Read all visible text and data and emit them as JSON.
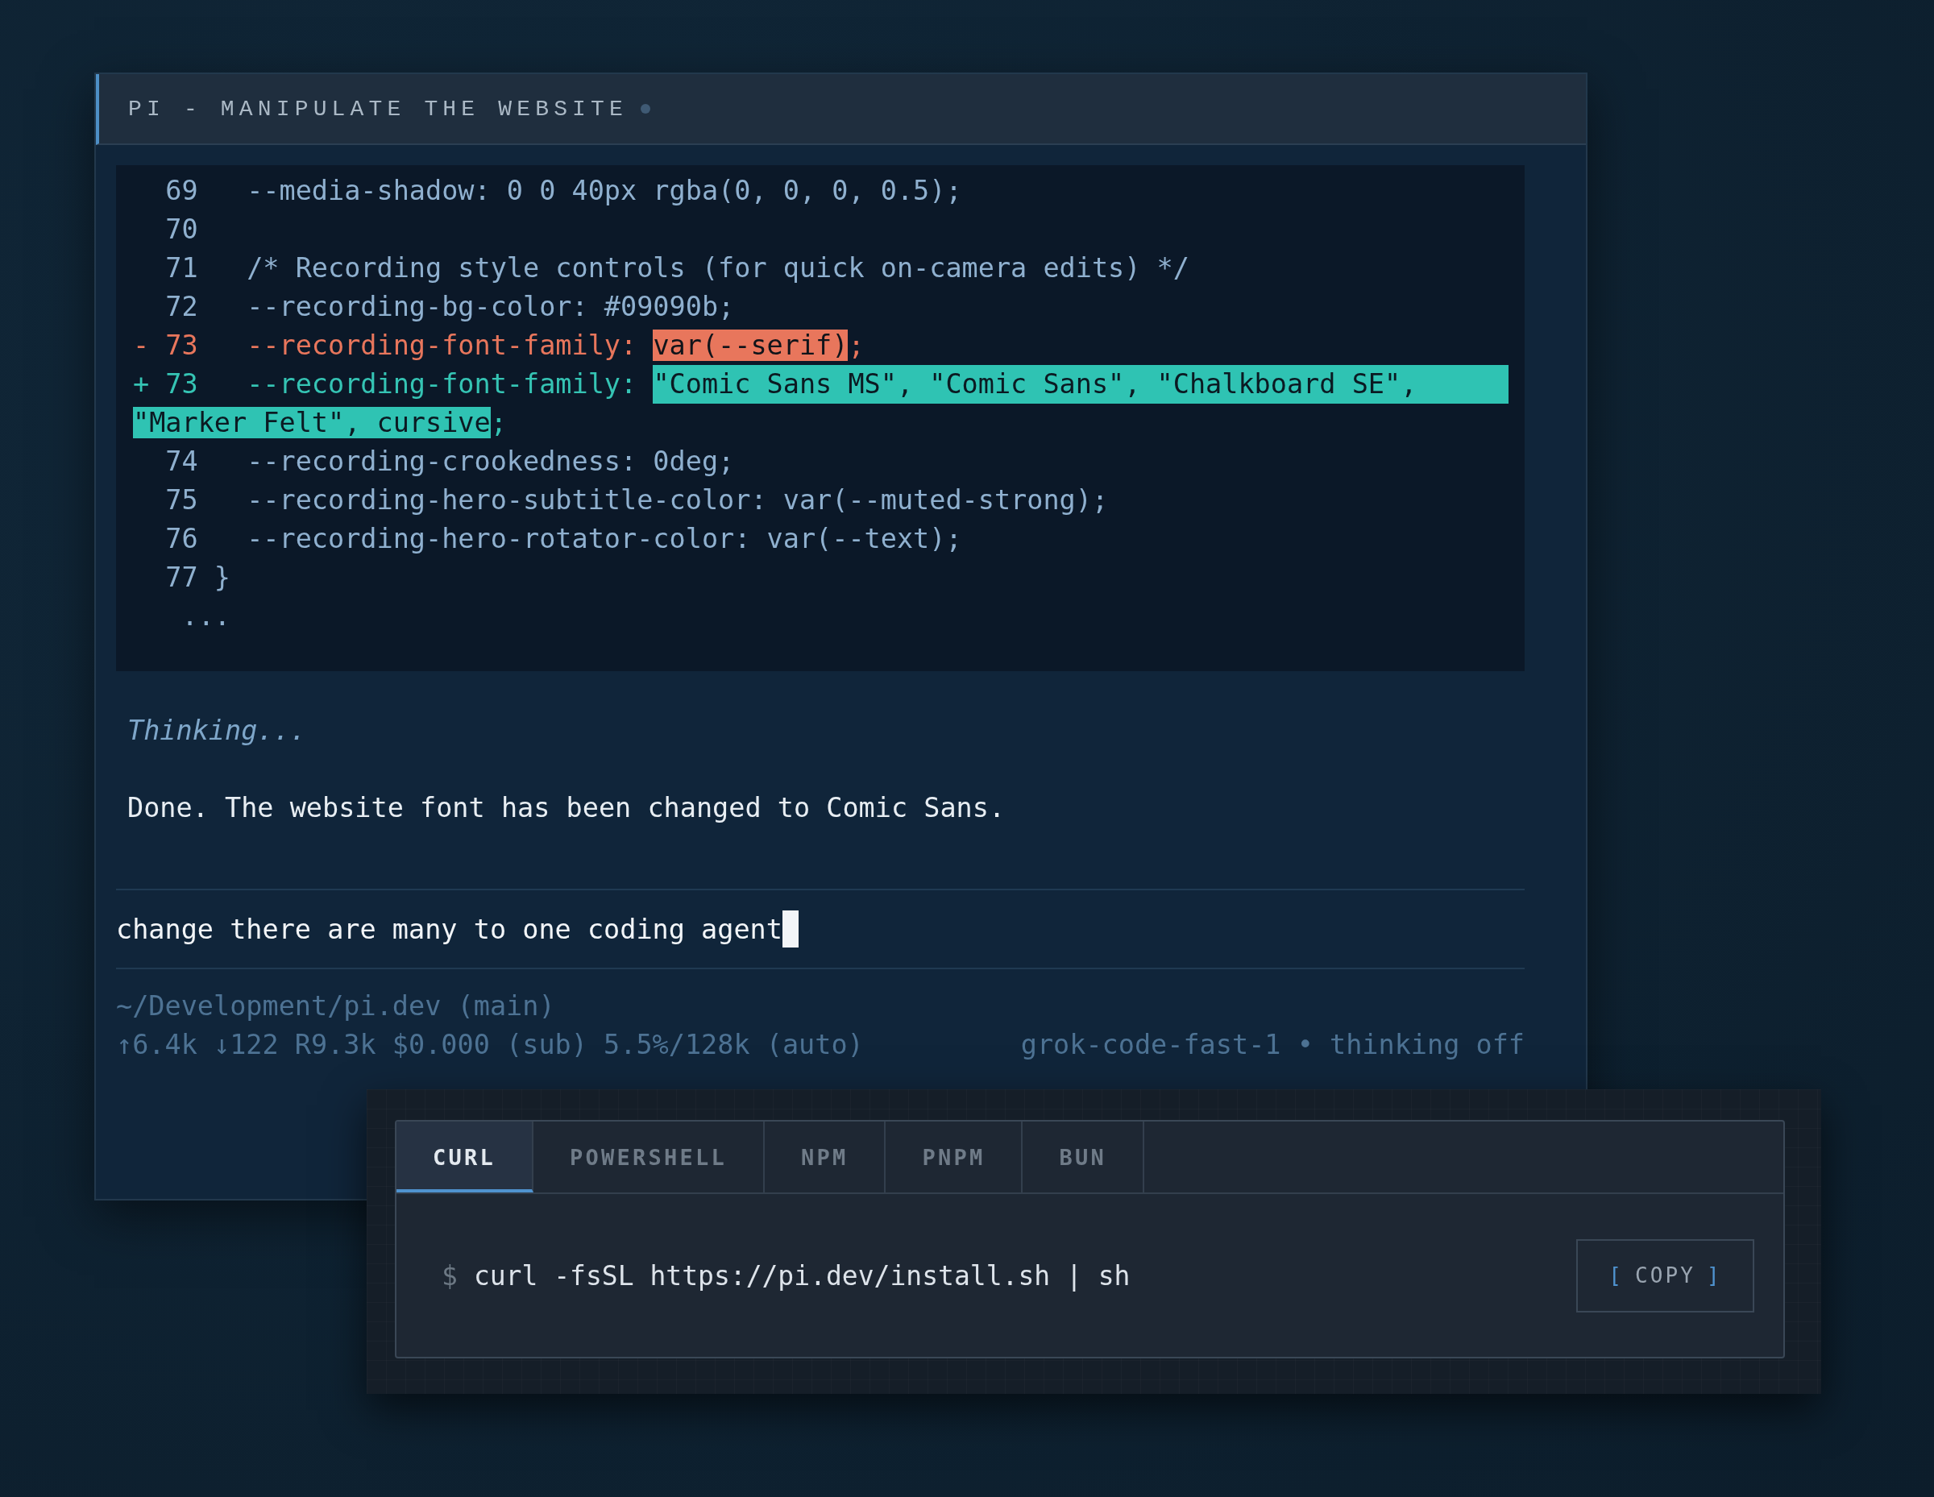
{
  "window": {
    "title": "PI - MANIPULATE THE WEBSITE"
  },
  "diff": {
    "lines": [
      {
        "kind": "context",
        "number": "69",
        "text": "--media-shadow: 0 0 40px rgba(0, 0, 0, 0.5);"
      },
      {
        "kind": "context",
        "number": "70"
      },
      {
        "kind": "context",
        "number": "71",
        "text": "/* Recording style controls (for quick on-camera edits) */"
      },
      {
        "kind": "context",
        "number": "72",
        "text": "--recording-bg-color: #09090b;"
      },
      {
        "kind": "removed",
        "sign": "-",
        "number": "73",
        "text": "--recording-font-family: ",
        "highlight": "var(--serif)",
        "tail": ";"
      },
      {
        "kind": "added",
        "sign": "+",
        "number": "73",
        "text": "--recording-font-family: ",
        "highlight": [
          "\"Comic Sans MS\", \"Comic Sans\", \"Chalkboard SE\",",
          "\"Marker Felt\", cursive"
        ],
        "tail": ";"
      },
      {
        "kind": "context",
        "number": "74",
        "text": "--recording-crookedness: 0deg;"
      },
      {
        "kind": "context",
        "number": "75",
        "text": "--recording-hero-subtitle-color: var(--muted-strong);"
      },
      {
        "kind": "context",
        "number": "76",
        "text": "--recording-hero-rotator-color: var(--text);"
      },
      {
        "kind": "close",
        "number": "77",
        "text": "}"
      }
    ],
    "ellipsis": "..."
  },
  "thinking": "Thinking...",
  "response": "Done. The website font has been changed to Comic Sans.",
  "input": {
    "value": "change there are many to one coding agent"
  },
  "status": {
    "path": "~/Development/pi.dev (main)",
    "stats": "↑6.4k ↓122 R9.3k $0.000 (sub) 5.5%/128k (auto)",
    "model": "grok-code-fast-1 • thinking off"
  },
  "install": {
    "tabs": [
      {
        "label": "CURL",
        "selected": true
      },
      {
        "label": "POWERSHELL",
        "selected": false
      },
      {
        "label": "NPM",
        "selected": false
      },
      {
        "label": "PNPM",
        "selected": false
      },
      {
        "label": "BUN",
        "selected": false
      }
    ],
    "prompt": "$",
    "command": "curl -fsSL https://pi.dev/install.sh | sh",
    "copy": {
      "open": "[",
      "label": "COPY",
      "close": "]"
    }
  }
}
